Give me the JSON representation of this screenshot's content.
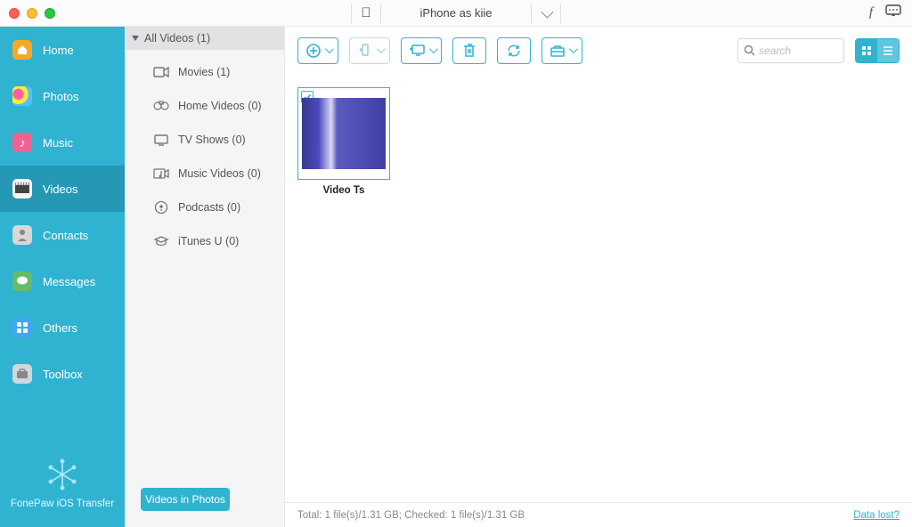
{
  "titlebar": {
    "device_name": "iPhone as kiie"
  },
  "sidebar": {
    "items": [
      {
        "label": "Home"
      },
      {
        "label": "Photos"
      },
      {
        "label": "Music"
      },
      {
        "label": "Videos"
      },
      {
        "label": "Contacts"
      },
      {
        "label": "Messages"
      },
      {
        "label": "Others"
      },
      {
        "label": "Toolbox"
      }
    ],
    "brand": "FonePaw iOS Transfer"
  },
  "panel2": {
    "header": "All Videos (1)",
    "categories": [
      {
        "label": "Movies (1)"
      },
      {
        "label": "Home Videos (0)"
      },
      {
        "label": "TV Shows (0)"
      },
      {
        "label": "Music Videos (0)"
      },
      {
        "label": "Podcasts (0)"
      },
      {
        "label": "iTunes U (0)"
      }
    ],
    "bottom_button": "Videos in Photos"
  },
  "search": {
    "placeholder": "search"
  },
  "gallery": {
    "items": [
      {
        "label": "Video Ts"
      }
    ]
  },
  "statusbar": {
    "summary": "Total: 1 file(s)/1.31 GB; Checked: 1 file(s)/1.31 GB",
    "link": "Data lost?"
  }
}
